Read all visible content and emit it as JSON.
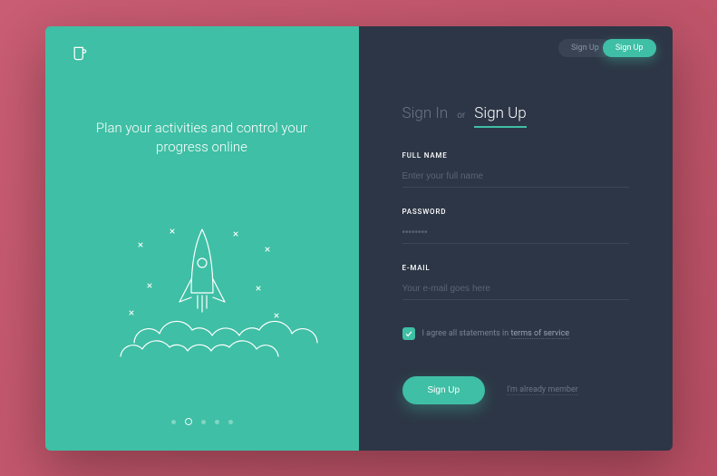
{
  "hero": {
    "tagline": "Plan your activities and control your progress online"
  },
  "top_tabs": {
    "signin": "Sign Up",
    "signup": "Sign Up"
  },
  "tabs": {
    "signin": "Sign In",
    "separator": "or",
    "signup": "Sign Up"
  },
  "form": {
    "fullname": {
      "label": "FULL NAME",
      "placeholder": "Enter your full name"
    },
    "password": {
      "label": "PASSWORD",
      "placeholder": "••••••••"
    },
    "email": {
      "label": "E-MAIL",
      "placeholder": "Your e-mail goes here"
    },
    "terms_prefix": "I agree all statements in",
    "terms_link": "terms of service",
    "submit": "Sign Up",
    "already_member": "I'm already member"
  }
}
